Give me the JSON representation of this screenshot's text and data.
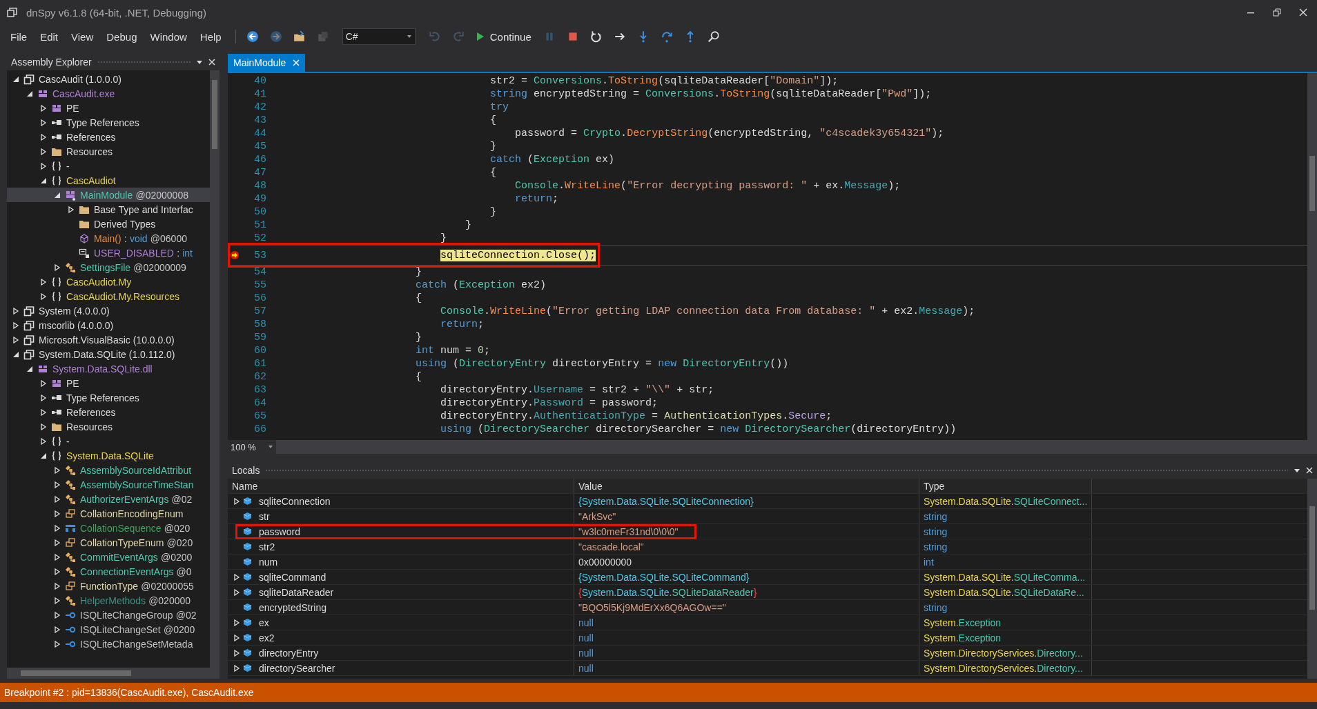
{
  "window": {
    "title": "dnSpy v6.1.8 (64-bit, .NET, Debugging)"
  },
  "menu": [
    "File",
    "Edit",
    "View",
    "Debug",
    "Window",
    "Help"
  ],
  "toolbar": [
    {
      "kind": "back",
      "disabled": false
    },
    {
      "kind": "forward",
      "disabled": true
    },
    {
      "kind": "open",
      "disabled": false
    },
    {
      "kind": "save",
      "disabled": true
    },
    {
      "kind": "language",
      "label": "C#"
    },
    {
      "kind": "undo",
      "disabled": true
    },
    {
      "kind": "redo",
      "disabled": true
    },
    {
      "kind": "continue",
      "label": "Continue",
      "disabled": false
    },
    {
      "kind": "pause",
      "disabled": true
    },
    {
      "kind": "stop",
      "disabled": false
    },
    {
      "kind": "restart",
      "disabled": false
    },
    {
      "kind": "next-statement",
      "disabled": false
    },
    {
      "kind": "step-into",
      "disabled": false
    },
    {
      "kind": "step-over",
      "disabled": false
    },
    {
      "kind": "step-out",
      "disabled": false
    },
    {
      "kind": "search",
      "disabled": false
    }
  ],
  "assembly_explorer": {
    "title": "Assembly Explorer",
    "tree": [
      {
        "kind": "assembly",
        "selected": false,
        "expanded": true,
        "label": [
          {
            "text": "CascAudit (1.0.0.0)",
            "kind": "plain"
          }
        ],
        "children": [
          {
            "kind": "module",
            "selected": false,
            "expanded": true,
            "label": [
              {
                "text": "CascAudit.exe",
                "kind": "module"
              }
            ],
            "children": [
              {
                "kind": "pe",
                "selected": false,
                "expanded": false,
                "label": [
                  {
                    "text": "PE",
                    "kind": "plain"
                  }
                ]
              },
              {
                "kind": "refs",
                "selected": false,
                "expanded": false,
                "label": [
                  {
                    "text": "Type References",
                    "kind": "plain"
                  }
                ]
              },
              {
                "kind": "refs",
                "selected": false,
                "expanded": false,
                "label": [
                  {
                    "text": "References",
                    "kind": "plain"
                  }
                ]
              },
              {
                "kind": "folder",
                "selected": false,
                "expanded": false,
                "label": [
                  {
                    "text": "Resources",
                    "kind": "plain"
                  }
                ]
              },
              {
                "kind": "namespace",
                "selected": false,
                "expanded": false,
                "label": [
                  {
                    "text": "-",
                    "kind": "plain"
                  }
                ]
              },
              {
                "kind": "namespace",
                "selected": false,
                "expanded": true,
                "label": [
                  {
                    "text": "CascAudiot",
                    "kind": "namespace"
                  }
                ],
                "children": [
                  {
                    "kind": "module-class",
                    "selected": true,
                    "expanded": true,
                    "label": [
                      {
                        "text": "MainModule",
                        "kind": "class"
                      },
                      {
                        "text": "@02000008",
                        "kind": "token"
                      }
                    ],
                    "children": [
                      {
                        "kind": "folder",
                        "selected": false,
                        "expanded": false,
                        "label": [
                          {
                            "text": "Base Type and Interfac",
                            "kind": "plain"
                          }
                        ]
                      },
                      {
                        "kind": "folder",
                        "selected": false,
                        "label": [
                          {
                            "text": "Derived Types",
                            "kind": "plain"
                          }
                        ]
                      },
                      {
                        "kind": "method",
                        "selected": false,
                        "label": [
                          {
                            "text": "Main()",
                            "kind": "method"
                          },
                          {
                            "text": ":",
                            "kind": "token"
                          },
                          {
                            "text": "void",
                            "kind": "keyword"
                          },
                          {
                            "text": "@06000",
                            "kind": "token"
                          }
                        ]
                      },
                      {
                        "kind": "field",
                        "selected": false,
                        "label": [
                          {
                            "text": "USER_DISABLED",
                            "kind": "field"
                          },
                          {
                            "text": ":",
                            "kind": "token"
                          },
                          {
                            "text": "int",
                            "kind": "keyword"
                          }
                        ]
                      }
                    ]
                  },
                  {
                    "kind": "class",
                    "selected": false,
                    "expanded": false,
                    "label": [
                      {
                        "text": "SettingsFile",
                        "kind": "class"
                      },
                      {
                        "text": "@02000009",
                        "kind": "token"
                      }
                    ]
                  }
                ]
              },
              {
                "kind": "namespace",
                "selected": false,
                "expanded": false,
                "label": [
                  {
                    "text": "CascAudiot.My",
                    "kind": "namespace"
                  }
                ]
              },
              {
                "kind": "namespace",
                "selected": false,
                "expanded": false,
                "label": [
                  {
                    "text": "CascAudiot.My.Resources",
                    "kind": "namespace"
                  }
                ]
              }
            ]
          }
        ]
      },
      {
        "kind": "assembly",
        "selected": false,
        "expanded": false,
        "label": [
          {
            "text": "System (4.0.0.0)",
            "kind": "plain"
          }
        ]
      },
      {
        "kind": "assembly",
        "selected": false,
        "expanded": false,
        "label": [
          {
            "text": "mscorlib (4.0.0.0)",
            "kind": "plain"
          }
        ]
      },
      {
        "kind": "assembly",
        "selected": false,
        "expanded": false,
        "label": [
          {
            "text": "Microsoft.VisualBasic (10.0.0.0)",
            "kind": "plain"
          }
        ]
      },
      {
        "kind": "assembly",
        "selected": false,
        "expanded": true,
        "label": [
          {
            "text": "System.Data.SQLite (1.0.112.0)",
            "kind": "plain"
          }
        ],
        "children": [
          {
            "kind": "module",
            "selected": false,
            "expanded": true,
            "label": [
              {
                "text": "System.Data.SQLite.dll",
                "kind": "module"
              }
            ],
            "children": [
              {
                "kind": "pe",
                "selected": false,
                "expanded": false,
                "label": [
                  {
                    "text": "PE",
                    "kind": "plain"
                  }
                ]
              },
              {
                "kind": "refs",
                "selected": false,
                "expanded": false,
                "label": [
                  {
                    "text": "Type References",
                    "kind": "plain"
                  }
                ]
              },
              {
                "kind": "refs",
                "selected": false,
                "expanded": false,
                "label": [
                  {
                    "text": "References",
                    "kind": "plain"
                  }
                ]
              },
              {
                "kind": "folder",
                "selected": false,
                "expanded": false,
                "label": [
                  {
                    "text": "Resources",
                    "kind": "plain"
                  }
                ]
              },
              {
                "kind": "namespace",
                "selected": false,
                "expanded": false,
                "label": [
                  {
                    "text": "-",
                    "kind": "plain"
                  }
                ]
              },
              {
                "kind": "namespace",
                "selected": false,
                "expanded": true,
                "label": [
                  {
                    "text": "System.Data.SQLite",
                    "kind": "namespace"
                  }
                ],
                "children": [
                  {
                    "kind": "class",
                    "selected": false,
                    "expanded": false,
                    "label": [
                      {
                        "text": "AssemblySourceIdAttribut",
                        "kind": "class"
                      }
                    ]
                  },
                  {
                    "kind": "class",
                    "selected": false,
                    "expanded": false,
                    "label": [
                      {
                        "text": "AssemblySourceTimeStan",
                        "kind": "class"
                      }
                    ]
                  },
                  {
                    "kind": "class",
                    "selected": false,
                    "expanded": false,
                    "label": [
                      {
                        "text": "AuthorizerEventArgs",
                        "kind": "class"
                      },
                      {
                        "text": "@02",
                        "kind": "token"
                      }
                    ]
                  },
                  {
                    "kind": "enum",
                    "selected": false,
                    "expanded": false,
                    "label": [
                      {
                        "text": "CollationEncodingEnum",
                        "kind": "enum"
                      }
                    ]
                  },
                  {
                    "kind": "struct",
                    "selected": false,
                    "expanded": false,
                    "label": [
                      {
                        "text": "CollationSequence",
                        "kind": "struct"
                      },
                      {
                        "text": "@020",
                        "kind": "token"
                      }
                    ]
                  },
                  {
                    "kind": "enum",
                    "selected": false,
                    "expanded": false,
                    "label": [
                      {
                        "text": "CollationTypeEnum",
                        "kind": "enum"
                      },
                      {
                        "text": "@020",
                        "kind": "token"
                      }
                    ]
                  },
                  {
                    "kind": "class",
                    "selected": false,
                    "expanded": false,
                    "label": [
                      {
                        "text": "CommitEventArgs",
                        "kind": "class"
                      },
                      {
                        "text": "@0200",
                        "kind": "token"
                      }
                    ]
                  },
                  {
                    "kind": "class",
                    "selected": false,
                    "expanded": false,
                    "label": [
                      {
                        "text": "ConnectionEventArgs",
                        "kind": "class"
                      },
                      {
                        "text": "@0",
                        "kind": "token"
                      }
                    ]
                  },
                  {
                    "kind": "enum",
                    "selected": false,
                    "expanded": false,
                    "label": [
                      {
                        "text": "FunctionType",
                        "kind": "enum"
                      },
                      {
                        "text": "@02000055",
                        "kind": "token"
                      }
                    ]
                  },
                  {
                    "kind": "static-class",
                    "selected": false,
                    "expanded": false,
                    "label": [
                      {
                        "text": "HelperMethods",
                        "kind": "static"
                      },
                      {
                        "text": "@020000",
                        "kind": "token"
                      }
                    ]
                  },
                  {
                    "kind": "interface",
                    "selected": false,
                    "expanded": false,
                    "label": [
                      {
                        "text": "ISQLiteChangeGroup",
                        "kind": "interface"
                      },
                      {
                        "text": "@02",
                        "kind": "token"
                      }
                    ]
                  },
                  {
                    "kind": "interface",
                    "selected": false,
                    "expanded": false,
                    "label": [
                      {
                        "text": "ISQLiteChangeSet",
                        "kind": "interface"
                      },
                      {
                        "text": "@0200",
                        "kind": "token"
                      }
                    ]
                  },
                  {
                    "kind": "interface",
                    "selected": false,
                    "expanded": false,
                    "label": [
                      {
                        "text": "ISQLiteChangeSetMetada",
                        "kind": "interface"
                      }
                    ]
                  }
                ]
              }
            ]
          }
        ]
      }
    ]
  },
  "editor": {
    "tabs": [
      {
        "label": "MainModule",
        "selected": true
      }
    ],
    "zoom": "100 %",
    "lines": [
      {
        "number": "40",
        "tokens": [
          {
            "text": "                                str2 = ",
            "kind": "plain"
          },
          {
            "text": "Conversions",
            "kind": "type"
          },
          {
            "text": ".",
            "kind": "plain"
          },
          {
            "text": "ToString",
            "kind": "method"
          },
          {
            "text": "(sqliteDataReader[",
            "kind": "plain"
          },
          {
            "text": "\"Domain\"",
            "kind": "string"
          },
          {
            "text": "]);",
            "kind": "plain"
          }
        ]
      },
      {
        "number": "41",
        "tokens": [
          {
            "text": "                                string",
            "kind": "keyword"
          },
          {
            "text": " encryptedString = ",
            "kind": "plain"
          },
          {
            "text": "Conversions",
            "kind": "type"
          },
          {
            "text": ".",
            "kind": "plain"
          },
          {
            "text": "ToString",
            "kind": "method"
          },
          {
            "text": "(sqliteDataReader[",
            "kind": "plain"
          },
          {
            "text": "\"Pwd\"",
            "kind": "string"
          },
          {
            "text": "]);",
            "kind": "plain"
          }
        ]
      },
      {
        "number": "42",
        "tokens": [
          {
            "text": "                                try",
            "kind": "keyword"
          }
        ]
      },
      {
        "number": "43",
        "tokens": [
          {
            "text": "                                {",
            "kind": "plain"
          }
        ]
      },
      {
        "number": "44",
        "tokens": [
          {
            "text": "                                    password = ",
            "kind": "plain"
          },
          {
            "text": "Crypto",
            "kind": "type"
          },
          {
            "text": ".",
            "kind": "plain"
          },
          {
            "text": "DecryptString",
            "kind": "method"
          },
          {
            "text": "(encryptedString, ",
            "kind": "plain"
          },
          {
            "text": "\"c4scadek3y654321\"",
            "kind": "string"
          },
          {
            "text": ");",
            "kind": "plain"
          }
        ]
      },
      {
        "number": "45",
        "tokens": [
          {
            "text": "                                }",
            "kind": "plain"
          }
        ]
      },
      {
        "number": "46",
        "tokens": [
          {
            "text": "                                catch",
            "kind": "keyword"
          },
          {
            "text": " (",
            "kind": "plain"
          },
          {
            "text": "Exception",
            "kind": "type"
          },
          {
            "text": " ex)",
            "kind": "plain"
          }
        ]
      },
      {
        "number": "47",
        "tokens": [
          {
            "text": "                                {",
            "kind": "plain"
          }
        ]
      },
      {
        "number": "48",
        "tokens": [
          {
            "text": "                                    Console",
            "kind": "type"
          },
          {
            "text": ".",
            "kind": "plain"
          },
          {
            "text": "WriteLine",
            "kind": "method"
          },
          {
            "text": "(",
            "kind": "plain"
          },
          {
            "text": "\"Error decrypting password: \"",
            "kind": "string"
          },
          {
            "text": " + ex.",
            "kind": "plain"
          },
          {
            "text": "Message",
            "kind": "property"
          },
          {
            "text": ");",
            "kind": "plain"
          }
        ]
      },
      {
        "number": "49",
        "tokens": [
          {
            "text": "                                    return",
            "kind": "keyword"
          },
          {
            "text": ";",
            "kind": "plain"
          }
        ]
      },
      {
        "number": "50",
        "tokens": [
          {
            "text": "                                }",
            "kind": "plain"
          }
        ]
      },
      {
        "number": "51",
        "tokens": [
          {
            "text": "                            }",
            "kind": "plain"
          }
        ]
      },
      {
        "number": "52",
        "tokens": [
          {
            "text": "                        }",
            "kind": "plain"
          }
        ]
      },
      {
        "number": "53",
        "current": true,
        "breakpoint": true,
        "highlighted": true,
        "tokens": [
          {
            "text": "                        sqliteConnection.Close();",
            "kind": "plain"
          }
        ]
      },
      {
        "number": "54",
        "tokens": [
          {
            "text": "                    }",
            "kind": "plain"
          }
        ]
      },
      {
        "number": "55",
        "tokens": [
          {
            "text": "                    catch",
            "kind": "keyword"
          },
          {
            "text": " (",
            "kind": "plain"
          },
          {
            "text": "Exception",
            "kind": "type"
          },
          {
            "text": " ex2)",
            "kind": "plain"
          }
        ]
      },
      {
        "number": "56",
        "tokens": [
          {
            "text": "                    {",
            "kind": "plain"
          }
        ]
      },
      {
        "number": "57",
        "tokens": [
          {
            "text": "                        Console",
            "kind": "type"
          },
          {
            "text": ".",
            "kind": "plain"
          },
          {
            "text": "WriteLine",
            "kind": "method"
          },
          {
            "text": "(",
            "kind": "plain"
          },
          {
            "text": "\"Error getting LDAP connection data From database: \"",
            "kind": "string"
          },
          {
            "text": " + ex2.",
            "kind": "plain"
          },
          {
            "text": "Message",
            "kind": "property"
          },
          {
            "text": ");",
            "kind": "plain"
          }
        ]
      },
      {
        "number": "58",
        "tokens": [
          {
            "text": "                        return",
            "kind": "keyword"
          },
          {
            "text": ";",
            "kind": "plain"
          }
        ]
      },
      {
        "number": "59",
        "tokens": [
          {
            "text": "                    }",
            "kind": "plain"
          }
        ]
      },
      {
        "number": "60",
        "tokens": [
          {
            "text": "                    int",
            "kind": "keyword"
          },
          {
            "text": " num = ",
            "kind": "plain"
          },
          {
            "text": "0",
            "kind": "number"
          },
          {
            "text": ";",
            "kind": "plain"
          }
        ]
      },
      {
        "number": "61",
        "tokens": [
          {
            "text": "                    using",
            "kind": "keyword"
          },
          {
            "text": " (",
            "kind": "plain"
          },
          {
            "text": "DirectoryEntry",
            "kind": "type"
          },
          {
            "text": " directoryEntry = ",
            "kind": "plain"
          },
          {
            "text": "new ",
            "kind": "keyword"
          },
          {
            "text": "DirectoryEntry",
            "kind": "type"
          },
          {
            "text": "())",
            "kind": "plain"
          }
        ]
      },
      {
        "number": "62",
        "tokens": [
          {
            "text": "                    {",
            "kind": "plain"
          }
        ]
      },
      {
        "number": "63",
        "tokens": [
          {
            "text": "                        directoryEntry.",
            "kind": "plain"
          },
          {
            "text": "Username",
            "kind": "property"
          },
          {
            "text": " = str2 + ",
            "kind": "plain"
          },
          {
            "text": "\"\\\\\"",
            "kind": "string"
          },
          {
            "text": " + str;",
            "kind": "plain"
          }
        ]
      },
      {
        "number": "64",
        "tokens": [
          {
            "text": "                        directoryEntry.",
            "kind": "plain"
          },
          {
            "text": "Password",
            "kind": "property"
          },
          {
            "text": " = password;",
            "kind": "plain"
          }
        ]
      },
      {
        "number": "65",
        "tokens": [
          {
            "text": "                        directoryEntry.",
            "kind": "plain"
          },
          {
            "text": "AuthenticationType",
            "kind": "property"
          },
          {
            "text": " = ",
            "kind": "plain"
          },
          {
            "text": "AuthenticationTypes",
            "kind": "enum"
          },
          {
            "text": ".",
            "kind": "plain"
          },
          {
            "text": "Secure",
            "kind": "enumvalue"
          },
          {
            "text": ";",
            "kind": "plain"
          }
        ]
      },
      {
        "number": "66",
        "tokens": [
          {
            "text": "                        using",
            "kind": "keyword"
          },
          {
            "text": " (",
            "kind": "plain"
          },
          {
            "text": "DirectorySearcher",
            "kind": "type"
          },
          {
            "text": " directorySearcher = ",
            "kind": "plain"
          },
          {
            "text": "new ",
            "kind": "keyword"
          },
          {
            "text": "DirectorySearcher",
            "kind": "type"
          },
          {
            "text": "(directoryEntry))",
            "kind": "plain"
          }
        ]
      }
    ]
  },
  "locals": {
    "title": "Locals",
    "columns": [
      "Name",
      "Value",
      "Type"
    ],
    "rows": [
      {
        "name": "sqliteConnection",
        "expanded": false,
        "value": [
          {
            "text": "{System.Data.SQLite.SQLiteConnection}",
            "kind": "object"
          }
        ],
        "type": [
          {
            "text": "System.Data.SQLite.",
            "kind": "namespace"
          },
          {
            "text": "SQLiteConnect...",
            "kind": "class"
          }
        ]
      },
      {
        "name": "str",
        "value": [
          {
            "text": "\"ArkSvc\"",
            "kind": "string"
          }
        ],
        "type": [
          {
            "text": "string",
            "kind": "keyword"
          }
        ]
      },
      {
        "name": "password",
        "highlighted": true,
        "value": [
          {
            "text": "\"w3lc0meFr31nd\\0\\0\\0\"",
            "kind": "string"
          }
        ],
        "type": [
          {
            "text": "string",
            "kind": "keyword"
          }
        ]
      },
      {
        "name": "str2",
        "value": [
          {
            "text": "\"cascade.local\"",
            "kind": "string"
          }
        ],
        "type": [
          {
            "text": "string",
            "kind": "keyword"
          }
        ]
      },
      {
        "name": "num",
        "value": [
          {
            "text": "0x00000000",
            "kind": "plain"
          }
        ],
        "type": [
          {
            "text": "int",
            "kind": "keyword"
          }
        ]
      },
      {
        "name": "sqliteCommand",
        "expanded": false,
        "value": [
          {
            "text": "{System.Data.SQLite.SQLiteCommand}",
            "kind": "object"
          }
        ],
        "type": [
          {
            "text": "System.Data.SQLite.",
            "kind": "namespace"
          },
          {
            "text": "SQLiteComma...",
            "kind": "class"
          }
        ]
      },
      {
        "name": "sqliteDataReader",
        "expanded": false,
        "value": [
          {
            "text": "{",
            "kind": "error"
          },
          {
            "text": "System.Data.SQLite.",
            "kind": "object"
          },
          {
            "text": "SQLiteDataReader",
            "kind": "class"
          },
          {
            "text": "}",
            "kind": "error"
          }
        ],
        "type": [
          {
            "text": "System.Data.SQLite.",
            "kind": "namespace"
          },
          {
            "text": "SQLiteDataRe...",
            "kind": "class"
          }
        ]
      },
      {
        "name": "encryptedString",
        "value": [
          {
            "text": "\"BQO5l5Kj9MdErXx6Q6AGOw==\"",
            "kind": "string"
          }
        ],
        "type": [
          {
            "text": "string",
            "kind": "keyword"
          }
        ]
      },
      {
        "name": "ex",
        "expanded": false,
        "value": [
          {
            "text": "null",
            "kind": "keyword"
          }
        ],
        "type": [
          {
            "text": "System.",
            "kind": "namespace"
          },
          {
            "text": "Exception",
            "kind": "class"
          }
        ]
      },
      {
        "name": "ex2",
        "expanded": false,
        "value": [
          {
            "text": "null",
            "kind": "keyword"
          }
        ],
        "type": [
          {
            "text": "System.",
            "kind": "namespace"
          },
          {
            "text": "Exception",
            "kind": "class"
          }
        ]
      },
      {
        "name": "directoryEntry",
        "expanded": false,
        "value": [
          {
            "text": "null",
            "kind": "keyword"
          }
        ],
        "type": [
          {
            "text": "System.DirectoryServices.",
            "kind": "namespace"
          },
          {
            "text": "Directory...",
            "kind": "class"
          }
        ]
      },
      {
        "name": "directorySearcher",
        "expanded": false,
        "value": [
          {
            "text": "null",
            "kind": "keyword"
          }
        ],
        "type": [
          {
            "text": "System.DirectoryServices.",
            "kind": "namespace"
          },
          {
            "text": "Directory...",
            "kind": "class"
          }
        ]
      }
    ]
  },
  "status_bar": "Breakpoint #2 : pid=13836(CascAudit.exe), CascAudit.exe"
}
